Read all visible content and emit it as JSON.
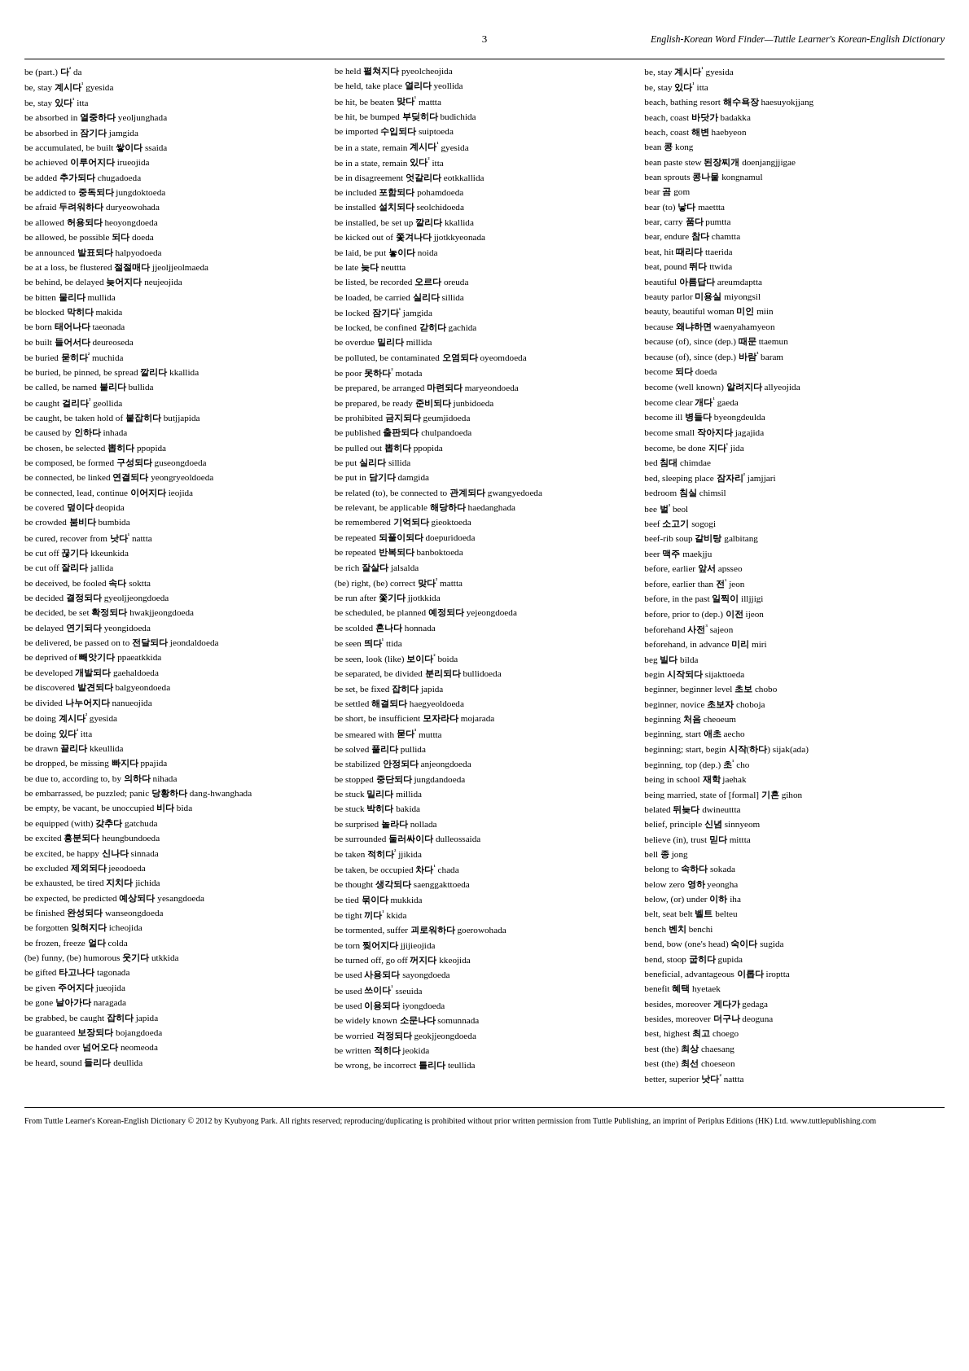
{
  "header": {
    "page_number": "3",
    "title": "English-Korean Word Finder—Tuttle Learner's Korean-English Dictionary"
  },
  "columns": [
    {
      "entries": [
        "be (part.) 다² da",
        "be, stay 계시다¹ gyesida",
        "be, stay 있다¹ itta",
        "be absorbed in 열중하다 yeoljunghada",
        "be absorbed in 잠기다 jamgida",
        "be accumulated, be built 쌓이다 ssaida",
        "be achieved 이루어지다 irueojida",
        "be added 추가되다 chugadoeda",
        "be addicted to 중독되다 jungdoktoeda",
        "be afraid 두려워하다 duryeowohada",
        "be allowed 허용되다 heoyongdoeda",
        "be allowed, be possible 되다 doeda",
        "be announced 발표되다 halpyodoeda",
        "be at a loss, be flustered 절절매다 jjeoljjeolmaeda",
        "be behind, be delayed 늦어지다 neujeojida",
        "be bitten 물리다 mullida",
        "be blocked 막히다 makida",
        "be born 태어나다 taeonada",
        "be built 들어서다 deureoseda",
        "be buried 묻히다² muchida",
        "be buried, be pinned, be spread 깔리다 kkallida",
        "be called, be named 불리다 bullida",
        "be caught 걸리다² geollida",
        "be caught, be taken hold of 붙잡히다 butjjapida",
        "be caused by 인하다 inhada",
        "be chosen, be selected 뽑히다 ppopida",
        "be composed, be formed 구성되다 guseongdoeda",
        "be connected, be linked 연결되다 yeongryeoldoeda",
        "be connected, lead, continue 이어지다 ieojida",
        "be covered 덮이다 deopida",
        "be crowded 붐비다 bumbida",
        "be cured, recover from 낫다¹ nattta",
        "be cut off 끊기다 kkeunkida",
        "be cut off 잘리다 jallida",
        "be deceived, be fooled 속다 soktta",
        "be decided 결정되다 gyeoljjeongdoeda",
        "be decided, be set 확정되다 hwakjjeongdoeda",
        "be delayed 연기되다 yeongidoeda",
        "be delivered, be passed on to 전달되다 jeondaldoeda",
        "be deprived of 빼앗기다 ppaeatkkida",
        "be developed 개발되다 gaehaldoeda",
        "be discovered 발견되다 balgyeondoeda",
        "be divided 나누어지다 nanueojida",
        "be doing 계시다² gyesida",
        "be doing 있다² itta",
        "be drawn 끌리다 kkeullida",
        "be dropped, be missing 빠지다 ppajida",
        "be due to, according to, by 의하다 nihada",
        "be embarrassed, be puzzled; panic 당황하다 dang-hwanghada",
        "be empty, be vacant, be unoccupied 비다 bida",
        "be equipped (with) 갖추다 gatchuda",
        "be excited 흥분되다 heungbundoeda",
        "be excited, be happy 신나다 sinnada",
        "be excluded 제외되다 jeeodoeda",
        "be exhausted, be tired 지치다 jichida",
        "be expected, be predicted 예상되다 yesangdoeda",
        "be finished 완성되다 wanseongdoeda",
        "be forgotten 잊혀지다 icheojida",
        "be frozen, freeze 얼다 colda",
        "(be) funny, (be) humorous 웃기다 utkkida",
        "be gifted 타고나다 tagonada",
        "be given 주어지다 jueojida",
        "be gone 날아가다 naragada",
        "be grabbed, be caught 잡히다 japida",
        "be guaranteed 보장되다 bojangdoeda",
        "be handed over 넘어오다 neomeoda",
        "be heard, sound 들리다 deullida"
      ]
    },
    {
      "entries": [
        "be held 펼쳐지다 pyeolcheojida",
        "be held, take place 열리다 yeollida",
        "be hit, be beaten 맞다¹ mattta",
        "be hit, be bumped 부딪히다 budichida",
        "be imported 수입되다 suiptoeda",
        "be in a state, remain 계시다¹ gyesida",
        "be in a state, remain 있다² itta",
        "be in disagreement 엇갈리다 eotkkallida",
        "be included 포함되다 pohamdoeda",
        "be installed 설치되다 seolchidoeda",
        "be installed, be set up 깔리다 kkallida",
        "be kicked out of 쫓겨나다 jjotkkyeonada",
        "be laid, be put 놓이다 noida",
        "be late 늦다 neuttta",
        "be listed, be recorded 오르다 oreuda",
        "be loaded, be carried 실리다 sillida",
        "be locked 잠기다¹ jamgida",
        "be locked, be confined 갇히다 gachida",
        "be overdue 밀리다 millida",
        "be polluted, be contaminated 오염되다 oyeomdoeda",
        "be poor 못하다² motada",
        "be prepared, be arranged 마련되다 maryeondoeda",
        "be prepared, be ready 준비되다 junbidoeda",
        "be prohibited 금지되다 geumjidoeda",
        "be published 출판되다 chulpandoeda",
        "be pulled out 뽑히다 ppopida",
        "be put 실리다 sillida",
        "be put in 담기다 damgida",
        "be related (to), be connected to 관계되다 gwangyedoeda",
        "be relevant, be applicable 해당하다 haedanghada",
        "be remembered 기억되다 gieoktoeda",
        "be repeated 되풀이되다 doepuridoeda",
        "be repeated 반복되다 banboktoeda",
        "be rich 잘살다 jalsalda",
        "(be) right, (be) correct 맞다² mattta",
        "be run after 쫓기다 jjotkkida",
        "be scheduled, be planned 예정되다 yejeongdoeda",
        "be scolded 혼나다 honnada",
        "be seen 띄다¹ ttida",
        "be seen, look (like) 보이다² boida",
        "be separated, be divided 분리되다 bullidoeda",
        "be set, be fixed 잡히다 japida",
        "be settled 해결되다 haegyeoldoeda",
        "be short, be insufficient 모자라다 mojarada",
        "be smeared with 묻다³ muttta",
        "be solved 풀리다 pullida",
        "be stabilized 안정되다 anjeongdoeda",
        "be stopped 중단되다 jungdandoeda",
        "be stuck 밀리다 millida",
        "be stuck 박히다 bakida",
        "be surprised 놀라다 nollada",
        "be surrounded 둘러싸이다 dulleossaida",
        "be taken 적히다² jjikida",
        "be taken, be occupied 차다¹ chada",
        "be thought 생각되다 saenggakttoeda",
        "be tied 묶이다 mukkida",
        "be tight 끼다¹ kkida",
        "be tormented, suffer 괴로워하다 goerowohada",
        "be torn 찢어지다 jjijieojida",
        "be turned off, go off 꺼지다 kkeojida",
        "be used 사용되다 sayongdoeda",
        "be used 쓰이다¹ sseuida",
        "be used 이용되다 iyongdoeda",
        "be widely known 소문나다 somunnada",
        "be worried 걱정되다 geokjjeongdoeda",
        "be written 적히다 jeokida",
        "be wrong, be incorrect 틀리다 teullida"
      ]
    },
    {
      "entries": [
        "be, stay 계시다¹ gyesida",
        "be, stay 있다¹ itta",
        "beach, bathing resort 해수욕장 haesuyokjjang",
        "beach, coast 바닷가 badakka",
        "beach, coast 해변 haebyeon",
        "bean 콩 kong",
        "bean paste stew 된장찌개 doenjangjjigae",
        "bean sprouts 콩나물 kongnamul",
        "bear 곰 gom",
        "bear (to) 낳다 maettta",
        "bear, carry 품다 pumtta",
        "bear, endure 참다 chamtta",
        "beat, hit 때리다 ttaerida",
        "beat, pound 뛰다 ttwida",
        "beautiful 아름답다 areumdaptta",
        "beauty parlor 미용실 miyongsil",
        "beauty, beautiful woman 미인 miin",
        "because 왜냐하면 waenyahamyeon",
        "because (of), since (dep.) 때문 ttaemun",
        "because (of), since (dep.) 바람³ baram",
        "become 되다 doeda",
        "become (well known) 알려지다 allyeojida",
        "become clear 개다¹ gaeda",
        "become ill 병들다 byeongdeulda",
        "become small 작아지다 jagajida",
        "become, be done 지다¹ jida",
        "bed 침대 chimdae",
        "bed, sleeping place 잠자리² jamjjari",
        "bedroom 침실 chimsil",
        "bee 벌² beol",
        "beef 소고기 sogogi",
        "beef-rib soup 갈비탕 galbitang",
        "beer 맥주 maekjju",
        "before, earlier 앞서 apsseo",
        "before, earlier than 전¹ jeon",
        "before, in the past 일찍이 illjjigi",
        "before, prior to (dep.) 이전 ijeon",
        "beforehand 사전³ sajeon",
        "beforehand, in advance 미리 miri",
        "beg 빌다 bilda",
        "begin 시작되다 sijakttoeda",
        "beginner, beginner level 초보 chobo",
        "beginner, novice 초보자 choboja",
        "beginning 처음 cheoeum",
        "beginning, start 애초 aecho",
        "beginning; start, begin 시작(하다) sijak(ada)",
        "beginning, top (dep.) 초¹ cho",
        "being in school 재학 jaehak",
        "being married, state of [formal] 기혼 gihon",
        "belated 뒤늦다 dwineuttta",
        "belief, principle 신념 sinnyeom",
        "believe (in), trust 믿다 mittta",
        "bell 종 jong",
        "belong to 속하다 sokada",
        "below zero 영하 yeongha",
        "below, (or) under 이하 iha",
        "belt, seat belt 벨트 belteu",
        "bench 벤치 benchi",
        "bend, bow (one's head) 숙이다 sugida",
        "bend, stoop 굽히다 gupida",
        "beneficial, advantageous 이롭다 iroptta",
        "benefit 혜택 hyetaek",
        "besides, moreover 게다가 gedaga",
        "besides, moreover 더구나 deoguna",
        "best, highest 최고 choego",
        "best (the) 최상 chaesang",
        "best (the) 최선 choeseon",
        "better, superior 낫다² nattta"
      ]
    }
  ],
  "footer": {
    "text": "From Tuttle Learner's Korean-English Dictionary © 2012 by Kyubyong Park. All rights reserved; reproducing/duplicating is prohibited without prior written permission from Tuttle Publishing, an imprint of Periplus Editions (HK) Ltd. www.tuttlepublishing.com"
  }
}
